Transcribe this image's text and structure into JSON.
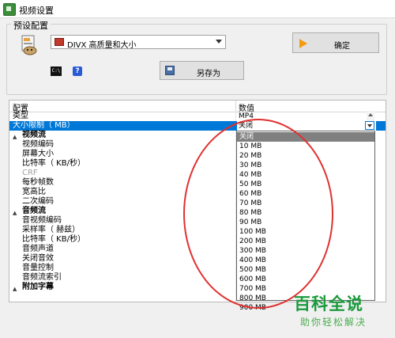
{
  "window": {
    "title": "视频设置"
  },
  "preset": {
    "group_label": "预设配置",
    "selected": "DIVX 高质量和大小",
    "ok_label": "确定",
    "save_as_label": "另存为",
    "cmd_icon_text": "C:\\"
  },
  "grid": {
    "header_config": "配置",
    "header_value": "数值",
    "rows": [
      {
        "name": "类型",
        "value": "MP4"
      },
      {
        "name": "大小限制（ MB）",
        "value": "关闭"
      },
      {
        "name": "视频流",
        "value": ""
      },
      {
        "name": "视频编码",
        "value": ""
      },
      {
        "name": "屏幕大小",
        "value": ""
      },
      {
        "name": "比特率（ KB/秒）",
        "value": ""
      },
      {
        "name": "CRF",
        "value": ""
      },
      {
        "name": "每秒帧数",
        "value": ""
      },
      {
        "name": "宽高比",
        "value": ""
      },
      {
        "name": "二次编码",
        "value": ""
      },
      {
        "name": "音频流",
        "value": ""
      },
      {
        "name": "音视频编码",
        "value": ""
      },
      {
        "name": "采样率（ 赫兹）",
        "value": ""
      },
      {
        "name": "比特率（ KB/秒）",
        "value": ""
      },
      {
        "name": "音频声道",
        "value": ""
      },
      {
        "name": "关闭音效",
        "value": ""
      },
      {
        "name": "音量控制",
        "value": ""
      },
      {
        "name": "音频流索引",
        "value": ""
      },
      {
        "name": "附加字幕",
        "value": ""
      }
    ]
  },
  "size_dropdown": {
    "options": [
      "关闭",
      "10 MB",
      "20 MB",
      "30 MB",
      "40 MB",
      "50 MB",
      "60 MB",
      "70 MB",
      "80 MB",
      "90 MB",
      "100 MB",
      "200 MB",
      "300 MB",
      "400 MB",
      "500 MB",
      "600 MB",
      "700 MB",
      "800 MB",
      "900 MB"
    ],
    "selected": "关闭"
  },
  "watermark": {
    "brand": "百科全说",
    "slogan": "助你轻松解决"
  },
  "colors": {
    "selection": "#0078d7",
    "annotation": "#e03030",
    "watermark": "#1a9a3c"
  }
}
